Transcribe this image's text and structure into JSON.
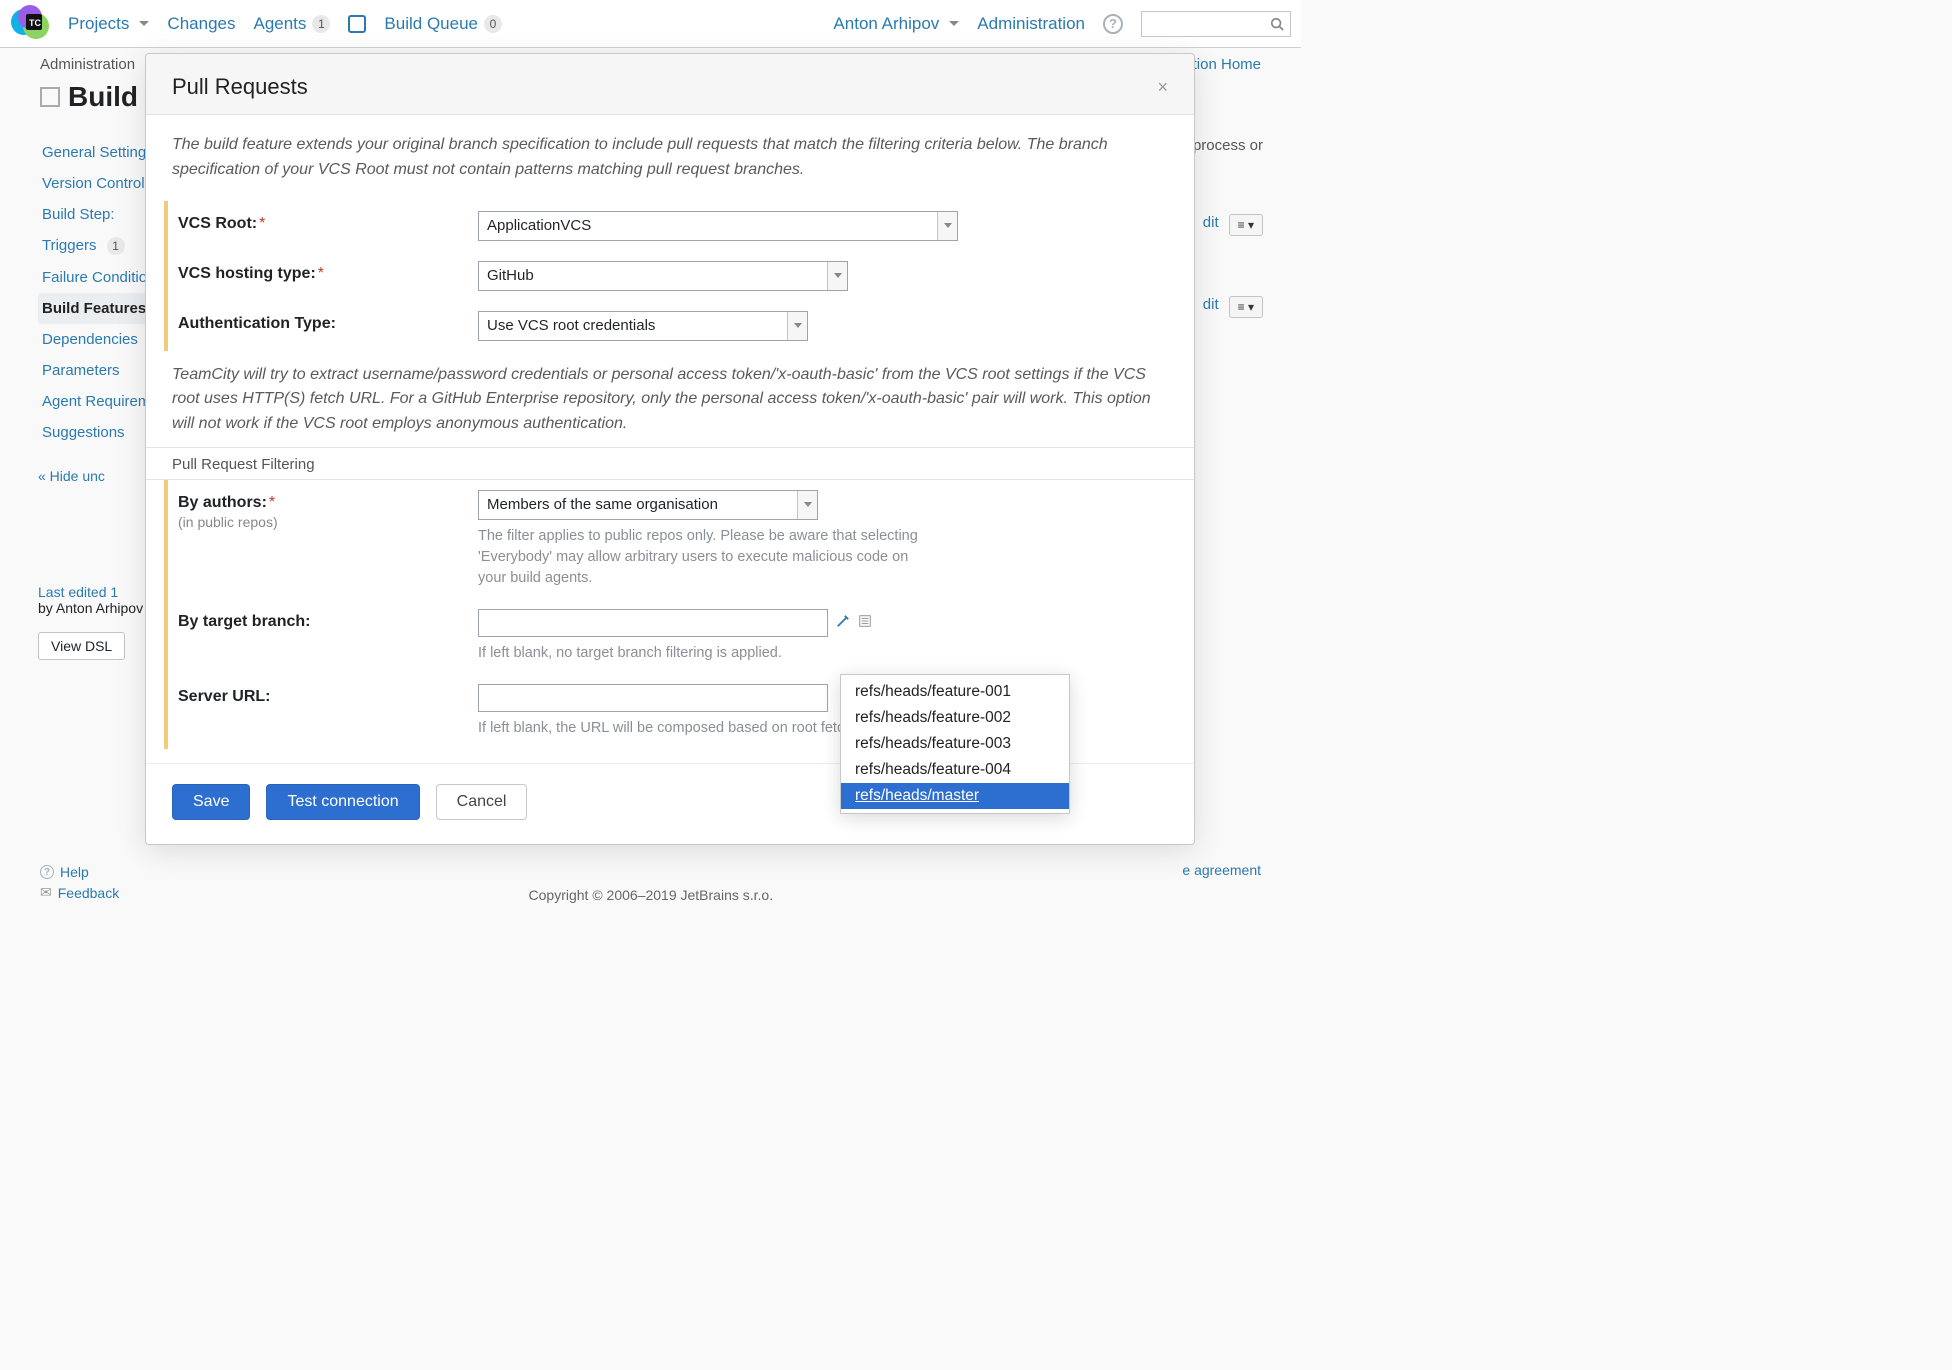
{
  "topnav": {
    "projects": "Projects",
    "changes": "Changes",
    "agents": "Agents",
    "agents_badge": "1",
    "build_queue": "Build Queue",
    "build_queue_badge": "0",
    "user": "Anton Arhipov",
    "administration": "Administration"
  },
  "breadcrumb": {
    "left": "Administration",
    "right": "uration Home"
  },
  "page_title": "Build",
  "sidebar": {
    "items": [
      "General Settings",
      "Version Control",
      "Build Step:",
      "Triggers",
      "Failure Conditions",
      "Build Features",
      "Dependencies",
      "Parameters",
      "Agent Requirements",
      "Suggestions"
    ],
    "triggers_badge": "1",
    "hide": "« Hide unc",
    "last_edited_line1": "Last edited 1",
    "last_edited_line2": "by Anton Arhipov",
    "view_dsl": "View DSL"
  },
  "main": {
    "rhs_text": "d process or",
    "edit_label": "dit",
    "options_icon_label": "≡ ▾"
  },
  "footer": {
    "help": "Help",
    "feedback": "Feedback",
    "copyright": "Copyright © 2006–2019 JetBrains s.r.o.",
    "agreement": "e agreement"
  },
  "modal": {
    "title": "Pull Requests",
    "intro": "The build feature extends your original branch specification to include pull requests that match the filtering criteria below. The branch specification of your VCS Root must not contain patterns matching pull request branches.",
    "vcs_root_label": "VCS Root:",
    "vcs_root_value": "ApplicationVCS",
    "hosting_label": "VCS hosting type:",
    "hosting_value": "GitHub",
    "auth_label": "Authentication Type:",
    "auth_value": "Use VCS root credentials",
    "auth_note": "TeamCity will try to extract username/password credentials or personal access token/'x-oauth-basic' from the VCS root settings if the VCS root uses HTTP(S) fetch URL. For a GitHub Enterprise repository, only the personal access token/'x-oauth-basic' pair will work. This option will not work if the VCS root employs anonymous authentication.",
    "filter_section": "Pull Request Filtering",
    "authors_label": "By authors:",
    "authors_sub": "(in public repos)",
    "authors_value": "Members of the same organisation",
    "authors_help": "The filter applies to public repos only. Please be aware that selecting 'Everybody' may allow arbitrary users to execute malicious code on your build agents.",
    "target_label": "By target branch:",
    "target_value": "",
    "target_help": "If left blank, no target branch filtering is applied.",
    "server_label": "Server URL:",
    "server_value": "",
    "server_help": "If left blank, the URL will be composed based on root fetch URL.",
    "save": "Save",
    "test": "Test connection",
    "cancel": "Cancel"
  },
  "branch_popup": {
    "items": [
      "refs/heads/feature-001",
      "refs/heads/feature-002",
      "refs/heads/feature-003",
      "refs/heads/feature-004",
      "refs/heads/master"
    ],
    "selected_index": 4
  }
}
